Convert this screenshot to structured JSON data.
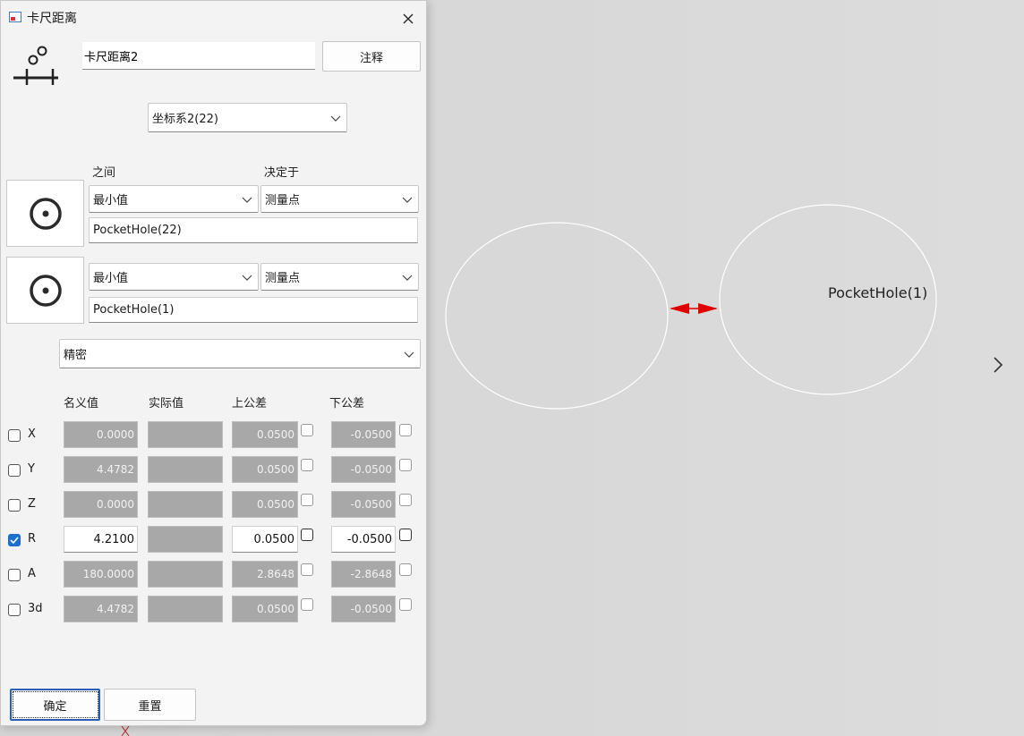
{
  "dialog": {
    "title": "卡尺距离",
    "name_value": "卡尺距离2",
    "annotate_label": "注释",
    "coord_system": "坐标系2(22)",
    "between_header": "之间",
    "decided_by_header": "决定于",
    "feature1": {
      "mode": "最小值",
      "point": "测量点",
      "name": "PocketHole(22)"
    },
    "feature2": {
      "mode": "最小值",
      "point": "测量点",
      "name": "PocketHole(1)"
    },
    "precision": "精密",
    "columns": {
      "nominal": "名义值",
      "actual": "实际值",
      "upper": "上公差",
      "lower": "下公差"
    },
    "rows": [
      {
        "label": "X",
        "checked": false,
        "nominal": "0.0000",
        "actual": "",
        "upper": "0.0500",
        "lower": "-0.0500"
      },
      {
        "label": "Y",
        "checked": false,
        "nominal": "4.4782",
        "actual": "",
        "upper": "0.0500",
        "lower": "-0.0500"
      },
      {
        "label": "Z",
        "checked": false,
        "nominal": "0.0000",
        "actual": "",
        "upper": "0.0500",
        "lower": "-0.0500"
      },
      {
        "label": "R",
        "checked": true,
        "nominal": "4.2100",
        "actual": "",
        "upper": "0.0500",
        "lower": "-0.0500"
      },
      {
        "label": "A",
        "checked": false,
        "nominal": "180.0000",
        "actual": "",
        "upper": "2.8648",
        "lower": "-2.8648"
      },
      {
        "label": "3d",
        "checked": false,
        "nominal": "4.4782",
        "actual": "",
        "upper": "0.0500",
        "lower": "-0.0500"
      }
    ],
    "ok_label": "确定",
    "reset_label": "重置"
  },
  "viewport": {
    "label": "PocketHole(1)",
    "arrow_color": "#e00000",
    "circle_color": "#ffffff"
  },
  "colors": {
    "accent": "#1a6fd1",
    "disabled_field": "#a8a8a8"
  }
}
